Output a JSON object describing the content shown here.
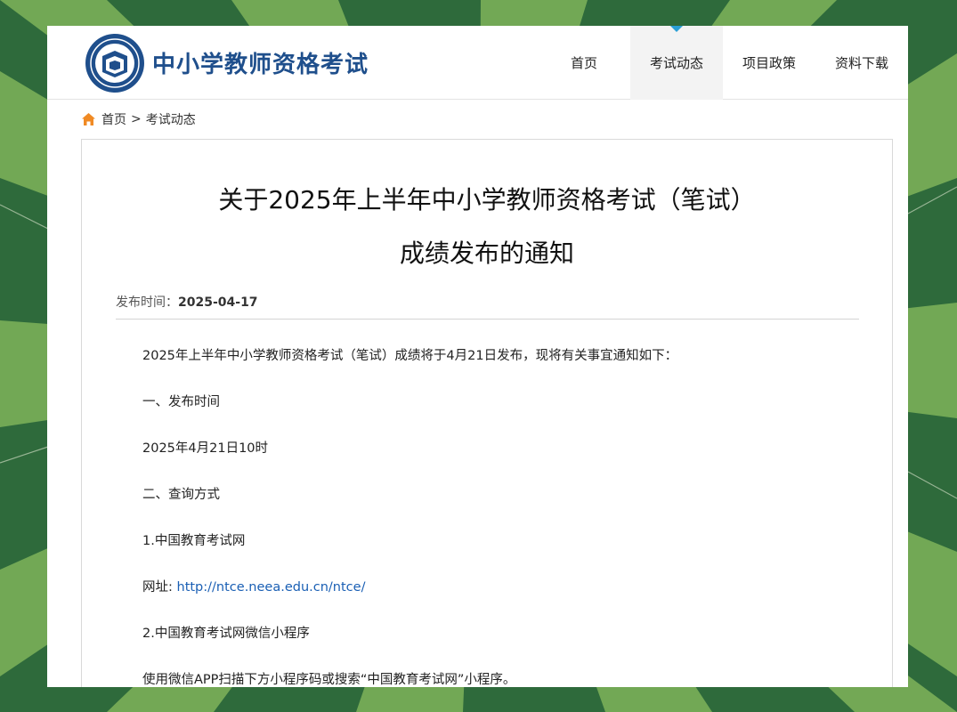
{
  "header": {
    "site_title": "中小学教师资格考试",
    "logo_icon": "exam-seal-icon",
    "brand_color": "#1f4f8c"
  },
  "nav": {
    "items": [
      {
        "label": "首页"
      },
      {
        "label": "考试动态"
      },
      {
        "label": "项目政策"
      },
      {
        "label": "资料下载"
      }
    ],
    "active_index": 1,
    "accent_color": "#2a9fd6"
  },
  "breadcrumb": {
    "home_icon": "home-icon",
    "home": "首页",
    "separator": ">",
    "current": "考试动态"
  },
  "article": {
    "title_line1": "关于2025年上半年中小学教师资格考试（笔试）",
    "title_line2": "成绩发布的通知",
    "date_label": "发布时间：",
    "date": "2025-04-17",
    "paragraphs": [
      "2025年上半年中小学教师资格考试（笔试）成绩将于4月21日发布，现将有关事宜通知如下：",
      "一、发布时间",
      "2025年4月21日10时",
      "二、查询方式",
      "1.中国教育考试网"
    ],
    "url_label": "网址: ",
    "url": "http://ntce.neea.edu.cn/ntce/",
    "paragraphs2": [
      "2.中国教育考试网微信小程序",
      "使用微信APP扫描下方小程序码或搜索“中国教育考试网”小程序。"
    ]
  }
}
